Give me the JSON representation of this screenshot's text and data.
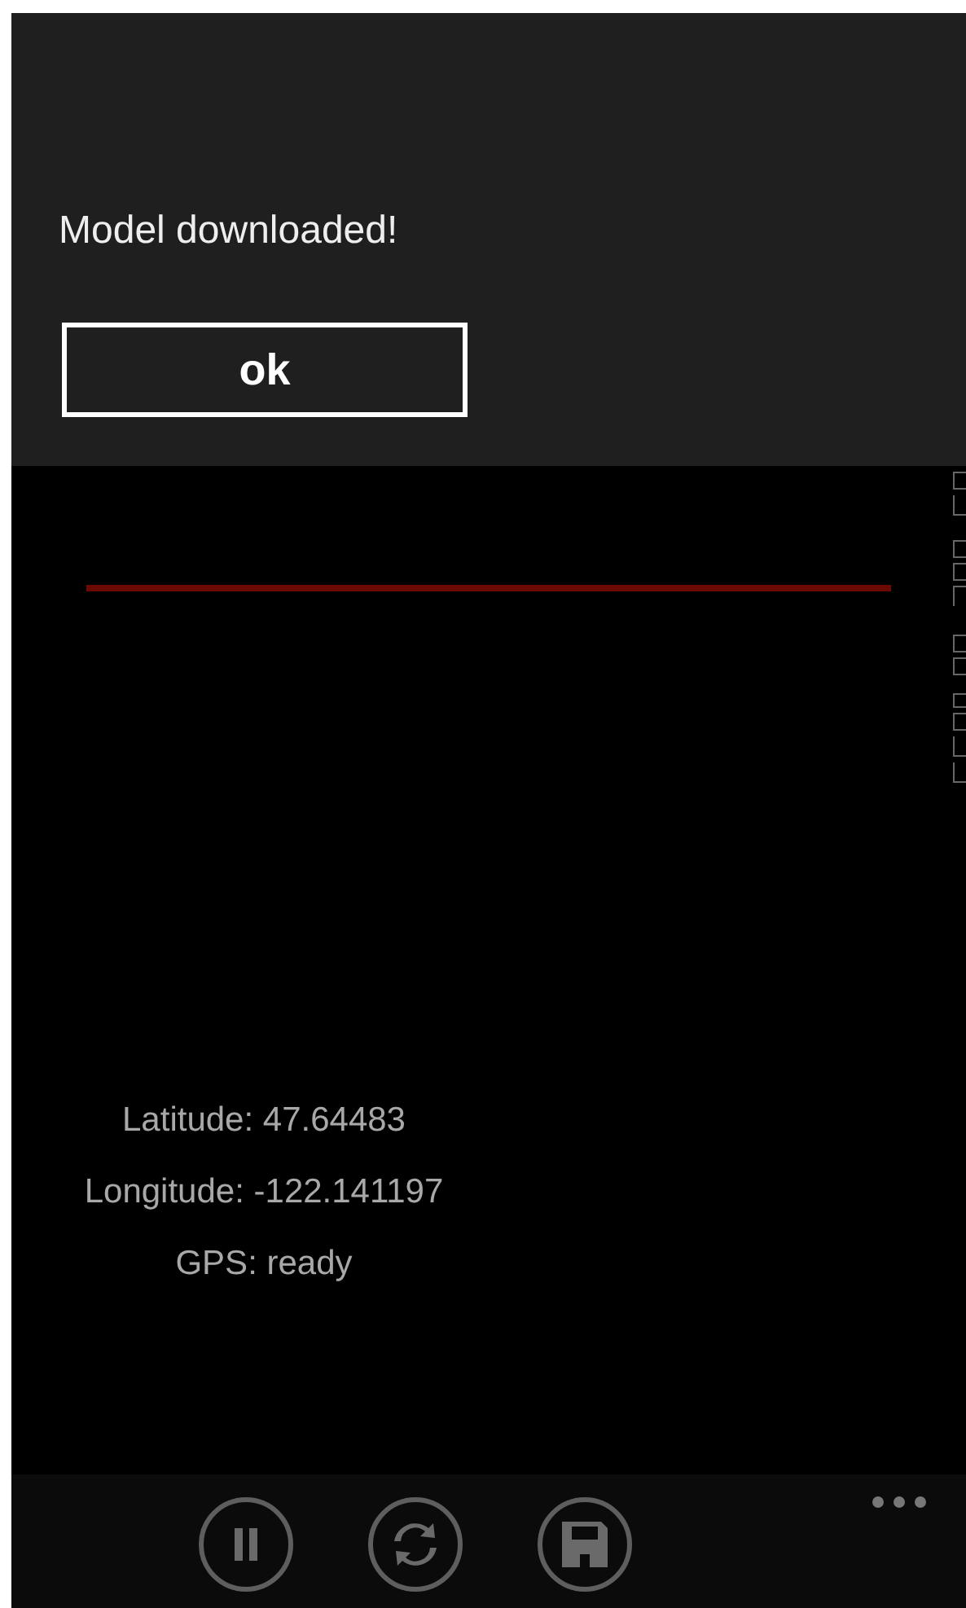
{
  "location": [
    {
      "text": "Latitude: 47.64483"
    },
    {
      "text": "Longitude: -122.141197"
    },
    {
      "text": "GPS: ready"
    }
  ],
  "dialog": {
    "message": "Model downloaded!",
    "button": "ok"
  },
  "app_bar": {
    "buttons": [
      {
        "kind": "pause"
      },
      {
        "kind": "refresh"
      },
      {
        "kind": "save"
      }
    ]
  }
}
